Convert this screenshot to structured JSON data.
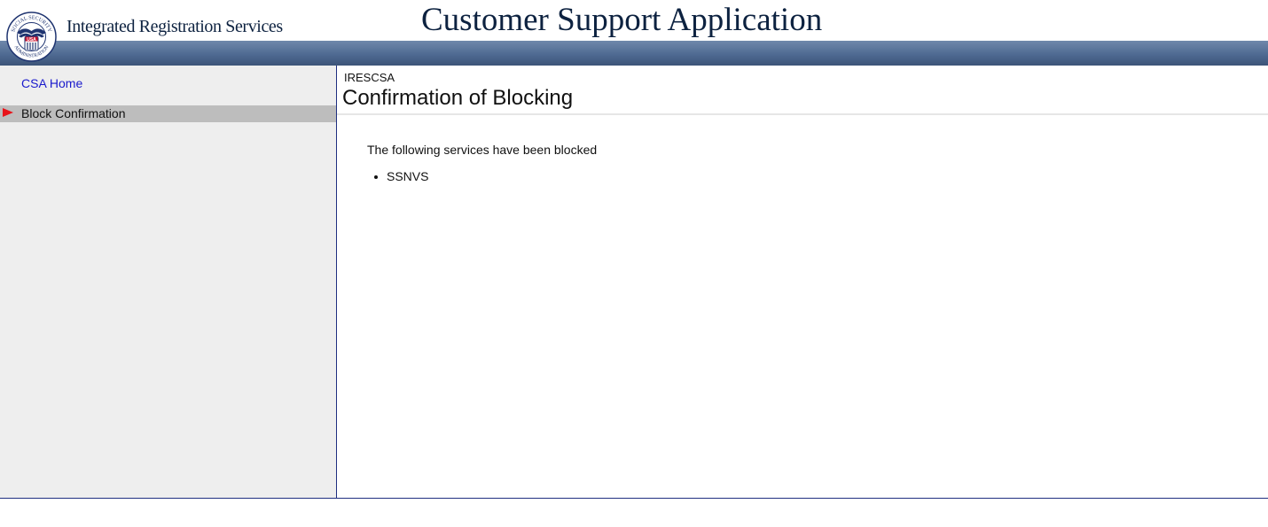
{
  "header": {
    "seal_top_text": "SOCIAL SECURITY",
    "seal_center_text": "USA",
    "seal_bottom_text": "ADMINISTRATION",
    "org_name": "Integrated Registration Services",
    "app_title": "Customer Support Application"
  },
  "sidebar": {
    "items": [
      {
        "label": "CSA Home",
        "active": false
      },
      {
        "label": "Block Confirmation",
        "active": true
      }
    ]
  },
  "main": {
    "breadcrumb": "IRESCSA",
    "title": "Confirmation of Blocking",
    "message": "The following services have been blocked",
    "services": [
      "SSNVS"
    ]
  },
  "colors": {
    "header_text": "#0d2240",
    "bar_top": "#6f88ab",
    "bar_bottom": "#3c5478",
    "sidebar_bg": "#eeeeee",
    "active_bg": "#bdbdbd",
    "active_arrow": "#e8141a",
    "link": "#1a1acc",
    "border": "#1f2f80"
  },
  "icons": {
    "seal": "ssa-seal-icon",
    "active_marker": "red-arrow-icon"
  }
}
